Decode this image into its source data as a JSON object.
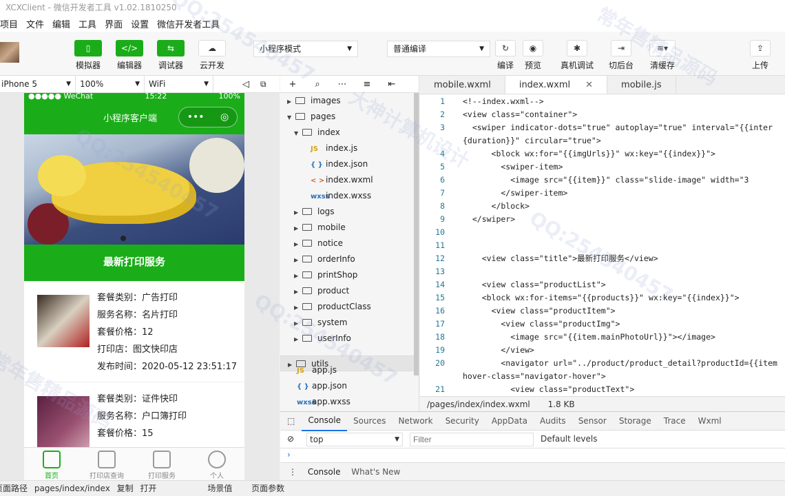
{
  "window": {
    "title": "XCXClient - 微信开发者工具 v1.02.1810250"
  },
  "menu": [
    "项目",
    "文件",
    "编辑",
    "工具",
    "界面",
    "设置",
    "微信开发者工具"
  ],
  "toolbar": {
    "simulator": "模拟器",
    "editor": "编辑器",
    "debugger": "调试器",
    "cloud": "云开发",
    "mode_select": "小程序模式",
    "compile_select": "普通编译",
    "compile": "编译",
    "preview": "预览",
    "remote_debug": "真机调试",
    "background": "切后台",
    "clear_cache": "清缓存",
    "upload": "上传"
  },
  "simbar": {
    "device": "iPhone 5",
    "zoom": "100%",
    "network": "WiFi"
  },
  "phone": {
    "status_carrier": "●●●●● WeChat",
    "status_time": "15:22",
    "status_battery": "100%",
    "nav_title": "小程序客户端",
    "section_title": "最新打印服务",
    "products": [
      {
        "l1": "套餐类别：广告打印",
        "l2": "服务名称：名片打印",
        "l3": "套餐价格：12",
        "l4": "打印店：图文快印店",
        "l5": "发布时间：2020-05-12 23:51:17"
      },
      {
        "l1": "套餐类别：证件快印",
        "l2": "服务名称：户口簿打印",
        "l3": "套餐价格：15"
      }
    ],
    "tabs": [
      "首页",
      "打印店查询",
      "打印服务",
      "个人"
    ]
  },
  "tree": [
    {
      "label": "images",
      "type": "folder",
      "depth": 0,
      "open": false
    },
    {
      "label": "pages",
      "type": "folder",
      "depth": 0,
      "open": true
    },
    {
      "label": "index",
      "type": "folder",
      "depth": 1,
      "open": true
    },
    {
      "label": "index.js",
      "type": "js",
      "depth": 2
    },
    {
      "label": "index.json",
      "type": "json",
      "depth": 2
    },
    {
      "label": "index.wxml",
      "type": "wxml",
      "depth": 2
    },
    {
      "label": "index.wxss",
      "type": "wxss",
      "depth": 2
    },
    {
      "label": "logs",
      "type": "folder",
      "depth": 1,
      "open": false
    },
    {
      "label": "mobile",
      "type": "folder",
      "depth": 1,
      "open": false
    },
    {
      "label": "notice",
      "type": "folder",
      "depth": 1,
      "open": false
    },
    {
      "label": "orderInfo",
      "type": "folder",
      "depth": 1,
      "open": false
    },
    {
      "label": "printShop",
      "type": "folder",
      "depth": 1,
      "open": false
    },
    {
      "label": "product",
      "type": "folder",
      "depth": 1,
      "open": false
    },
    {
      "label": "productClass",
      "type": "folder",
      "depth": 1,
      "open": false
    },
    {
      "label": "system",
      "type": "folder",
      "depth": 1,
      "open": false
    },
    {
      "label": "userInfo",
      "type": "folder",
      "depth": 1,
      "open": false
    },
    {
      "label": "utils",
      "type": "folder",
      "depth": 0,
      "open": false,
      "selected": true
    },
    {
      "label": "app.js",
      "type": "js",
      "depth": 0
    },
    {
      "label": "app.json",
      "type": "json",
      "depth": 0
    },
    {
      "label": "app.wxss",
      "type": "wxss",
      "depth": 0
    }
  ],
  "editor": {
    "tabs": [
      "mobile.wxml",
      "index.wxml",
      "mobile.js"
    ],
    "active_tab": 1,
    "lines": [
      {
        "n": "1",
        "t": "<!--index.wxml-->"
      },
      {
        "n": "2",
        "t": "<view class=\"container\">"
      },
      {
        "n": "3",
        "t": "  <swiper indicator-dots=\"true\" autoplay=\"true\" interval=\"{{inter"
      },
      {
        "n": "",
        "t": "{duration}}\" circular=\"true\">"
      },
      {
        "n": "4",
        "t": "      <block wx:for=\"{{imgUrls}}\" wx:key=\"{{index}}\">"
      },
      {
        "n": "5",
        "t": "        <swiper-item>"
      },
      {
        "n": "6",
        "t": "          <image src=\"{{item}}\" class=\"slide-image\" width=\"3"
      },
      {
        "n": "7",
        "t": "        </swiper-item>"
      },
      {
        "n": "8",
        "t": "      </block>"
      },
      {
        "n": "9",
        "t": "  </swiper>"
      },
      {
        "n": "10",
        "t": ""
      },
      {
        "n": "11",
        "t": ""
      },
      {
        "n": "12",
        "t": "    <view class=\"title\">最新打印服务</view>"
      },
      {
        "n": "13",
        "t": ""
      },
      {
        "n": "14",
        "t": "    <view class=\"productList\">"
      },
      {
        "n": "15",
        "t": "    <block wx:for-items=\"{{products}}\" wx:key=\"{{index}}\">"
      },
      {
        "n": "16",
        "t": "      <view class=\"productItem\">"
      },
      {
        "n": "17",
        "t": "        <view class=\"productImg\">"
      },
      {
        "n": "18",
        "t": "          <image src=\"{{item.mainPhotoUrl}}\"></image>"
      },
      {
        "n": "19",
        "t": "        </view>"
      },
      {
        "n": "20",
        "t": "        <navigator url=\"../product/product_detail?productId={{item"
      },
      {
        "n": "",
        "t": "hover-class=\"navigator-hover\">"
      },
      {
        "n": "21",
        "t": "          <view class=\"productText\">"
      }
    ],
    "status_path": "/pages/index/index.wxml",
    "status_size": "1.8 KB"
  },
  "console": {
    "tabs": [
      "Console",
      "Sources",
      "Network",
      "Security",
      "AppData",
      "Audits",
      "Sensor",
      "Storage",
      "Trace",
      "Wxml"
    ],
    "context": "top",
    "filter_placeholder": "Filter",
    "levels": "Default levels",
    "bottom_tabs": [
      "Console",
      "What's New"
    ]
  },
  "footer": {
    "label_path": "页面路径",
    "path": "pages/index/index",
    "copy": "复制",
    "open": "打开",
    "scene": "场景值",
    "params": "页面参数"
  },
  "watermarks": [
    "QQ:254540457",
    "大神计算机设计",
    "常年售精品源码"
  ]
}
